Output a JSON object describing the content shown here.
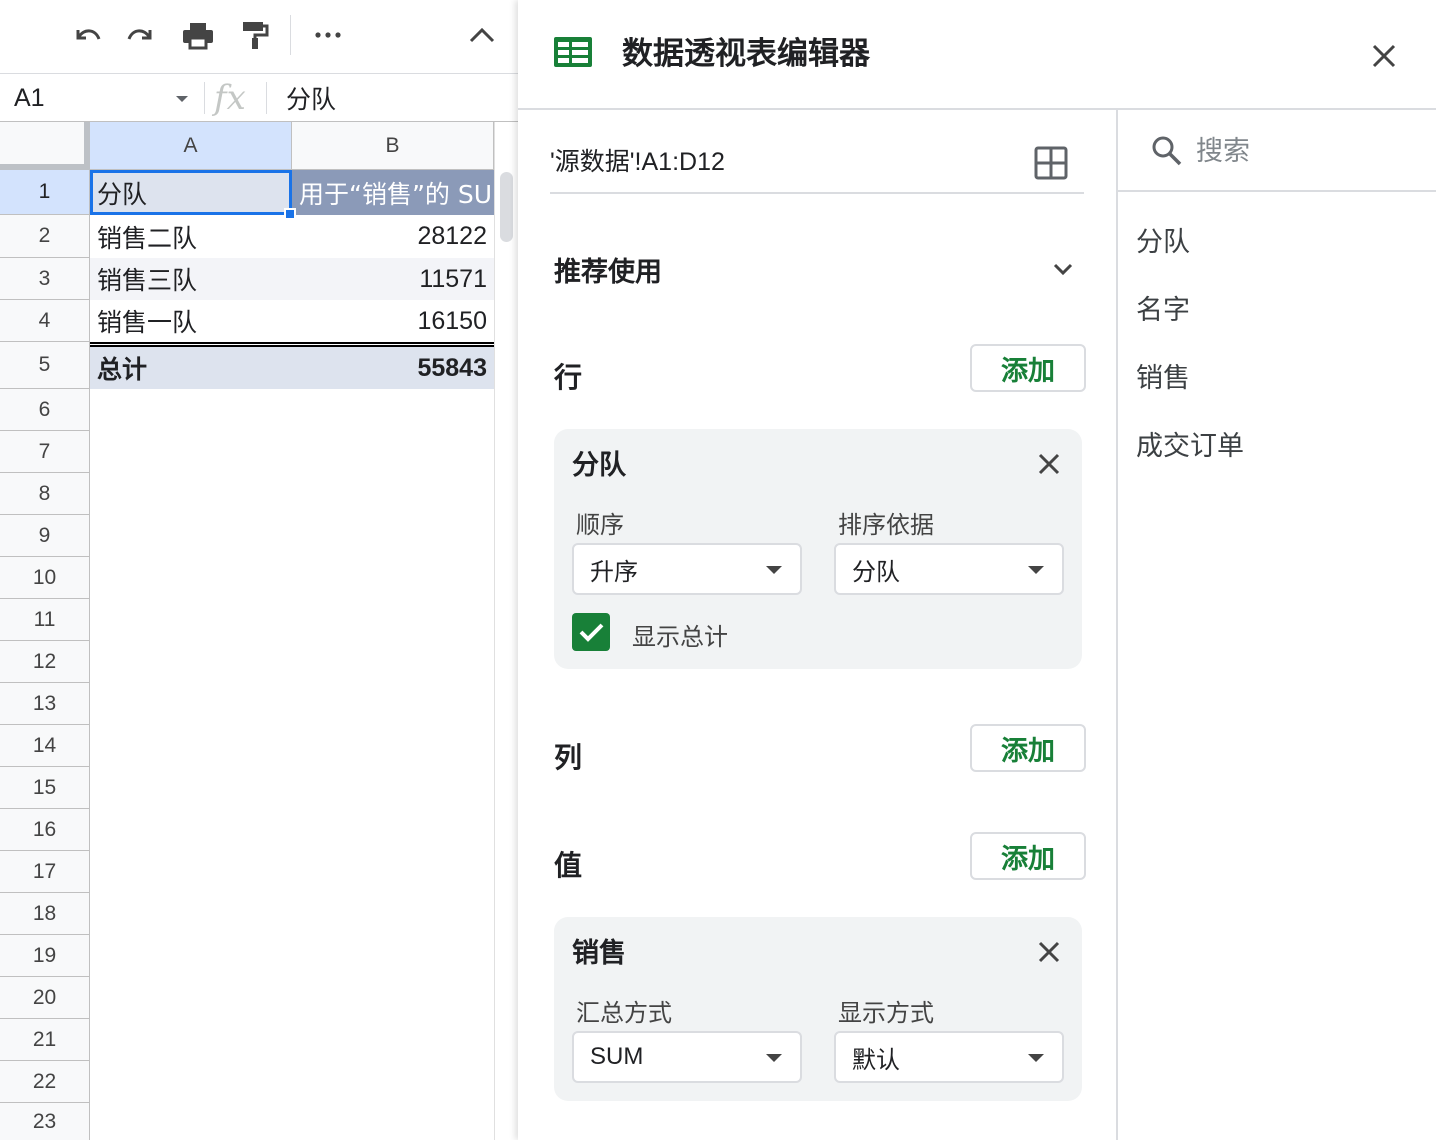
{
  "sheet": {
    "name_box": "A1",
    "fx_symbol": "fx",
    "formula_value": "分队",
    "columns": [
      "A",
      "B"
    ],
    "row_numbers": [
      "1",
      "2",
      "3",
      "4",
      "5",
      "6",
      "7",
      "8",
      "9",
      "10",
      "11",
      "12",
      "13",
      "14",
      "15",
      "16",
      "17",
      "18",
      "19",
      "20",
      "21",
      "22",
      "23"
    ],
    "cells": {
      "a1": "分队",
      "b1": "用于“销售”的 SUM",
      "a2": "销售二队",
      "b2": "28122",
      "a3": "销售三队",
      "b3": "11571",
      "a4": "销售一队",
      "b4": "16150",
      "a5": "总计",
      "b5": "55843"
    },
    "colors": {
      "selection": "#1a73e8",
      "header_fill": "#8b9ab8",
      "total_fill": "#dde3ee"
    }
  },
  "editor": {
    "title": "数据透视表编辑器",
    "source_range": "'源数据'!A1:D12",
    "suggested_label": "推荐使用",
    "rows_label": "行",
    "columns_label": "列",
    "values_label": "值",
    "add_label": "添加",
    "row_card": {
      "title": "分队",
      "order_label": "顺序",
      "order_value": "升序",
      "sort_by_label": "排序依据",
      "sort_by_value": "分队",
      "show_totals_label": "显示总计",
      "show_totals_checked": true
    },
    "value_card": {
      "title": "销售",
      "summarize_label": "汇总方式",
      "summarize_value": "SUM",
      "show_as_label": "显示方式",
      "show_as_value": "默认"
    },
    "accent_color": "#188038"
  },
  "fields": {
    "search_placeholder": "搜索",
    "items": [
      "分队",
      "名字",
      "销售",
      "成交订单"
    ]
  },
  "icons": [
    "undo-icon",
    "redo-icon",
    "print-icon",
    "paint-format-icon",
    "more-icon",
    "collapse-icon",
    "sheets-logo-icon",
    "close-icon",
    "grid-icon",
    "chevron-down-icon",
    "search-icon",
    "check-icon"
  ]
}
